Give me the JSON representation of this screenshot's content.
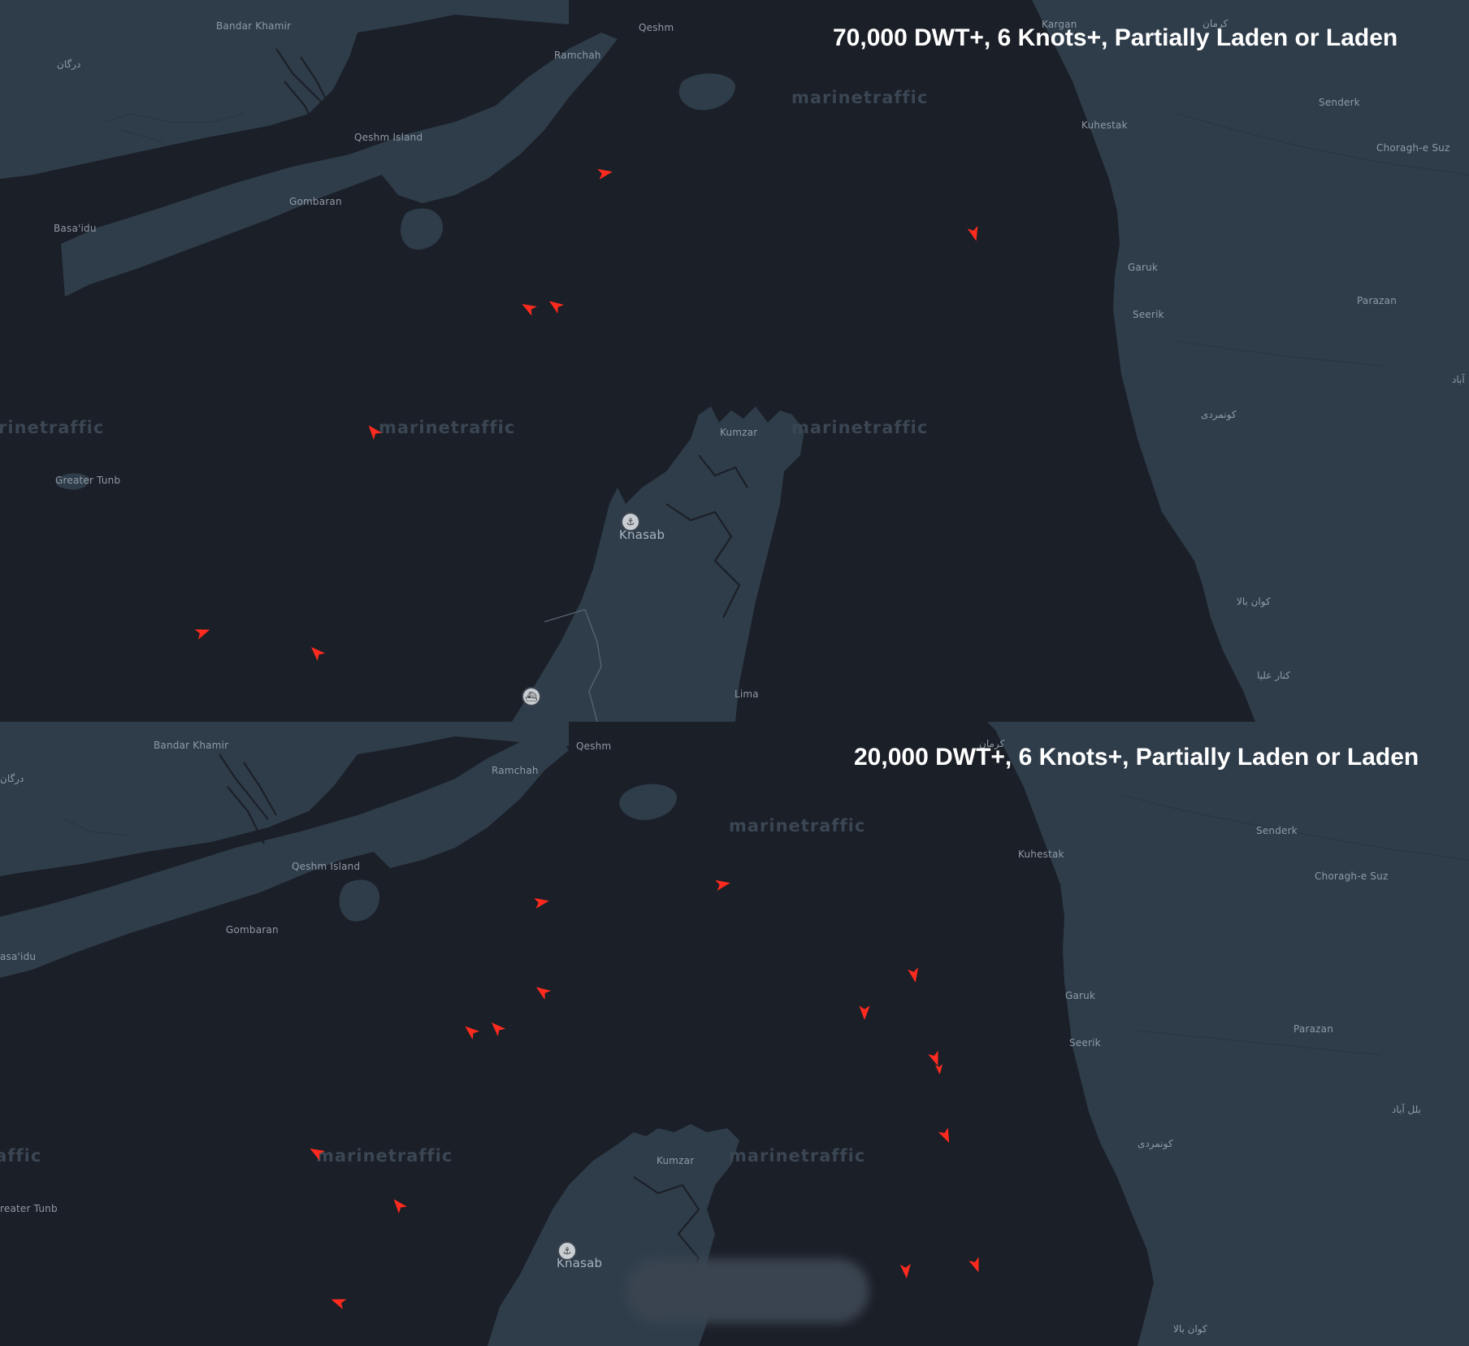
{
  "colors": {
    "sea": "#1b1f27",
    "land": "#2f3d4b",
    "vessel": "#ff2b1f",
    "title": "#ffffff",
    "watermark": "#3a4653"
  },
  "panels": [
    {
      "title": "70,000 DWT+, 6 Knots+, Partially Laden or Laden",
      "watermark": "marinetraffic",
      "places": [
        "Bandar Khamir",
        "درگان",
        "Qeshm",
        "Ramchah",
        "Qeshm Island",
        "Gombaran",
        "Basa'idu",
        "Greater Tunb",
        "Kargan",
        "کرمان",
        "Senderk",
        "Kuhestak",
        "Choragh-e Suz",
        "Garuk",
        "Seerik",
        "Parazan",
        "کونمردی",
        "Kumzar",
        "Khasab",
        "Lima",
        "کوان بالا",
        "کنار علیا",
        "آباد"
      ],
      "pins": [
        "harbor-icon",
        "ferry-icon"
      ],
      "vessel_count": 9
    },
    {
      "title": "20,000 DWT+, 6 Knots+, Partially Laden or Laden",
      "watermark": "marinetraffic",
      "places": [
        "Bandar Khamir",
        "درگان",
        "Qeshm",
        "Ramchah",
        "Qeshm Island",
        "Gombaran",
        "asa'idu",
        "reater Tunb",
        "کرمان",
        "Senderk",
        "Kuhestak",
        "Choragh-e Suz",
        "Garuk",
        "Seerik",
        "Parazan",
        "کونمردی",
        "بلل آباد",
        "Kumzar",
        "Khasab",
        "کوان بالا"
      ],
      "pins": [
        "harbor-icon"
      ],
      "vessel_count": 17
    }
  ]
}
